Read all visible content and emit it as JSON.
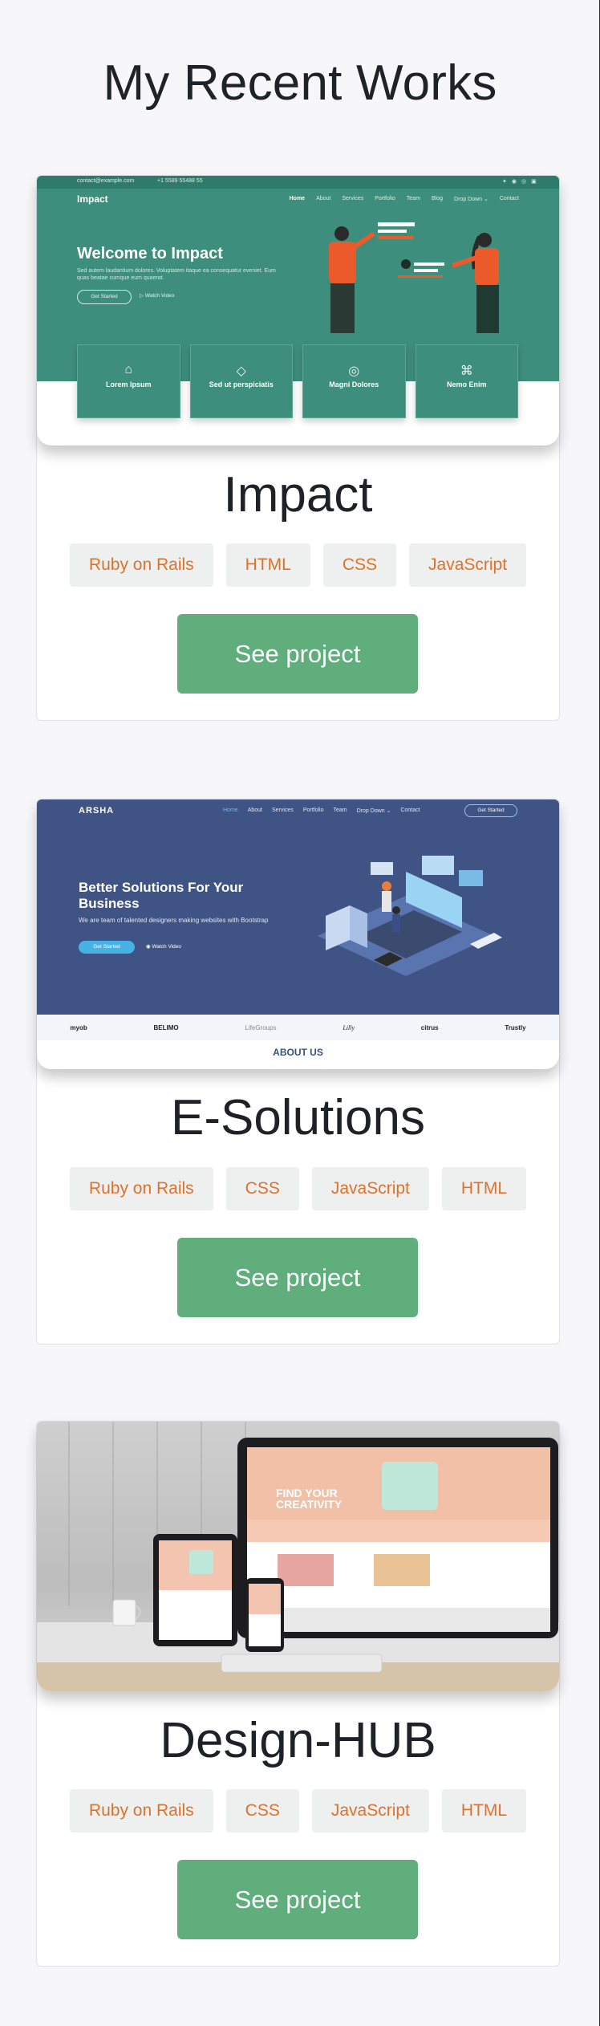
{
  "section": {
    "title": "My Recent Works"
  },
  "projects": [
    {
      "name": "Impact",
      "tags": [
        "Ruby on Rails",
        "HTML",
        "CSS",
        "JavaScript"
      ],
      "button": "See project",
      "preview": {
        "topbar_email": "contact@example.com",
        "topbar_phone": "+1 5589 55488 55",
        "logo": "Impact",
        "nav": [
          "Home",
          "About",
          "Services",
          "Portfolio",
          "Team",
          "Blog",
          "Drop Down ⌄",
          "Contact"
        ],
        "hero_title": "Welcome to Impact",
        "hero_text": "Sed autem laudantium dolores. Voluptatem itaque ea consequatur eveniet. Eum quas beatae cumque eum quaerat.",
        "btn_primary": "Get Started",
        "btn_secondary": "Watch Video",
        "boxes": [
          {
            "icon": "easel-icon",
            "glyph": "⌂",
            "label": "Lorem Ipsum"
          },
          {
            "icon": "gem-icon",
            "glyph": "◇",
            "label": "Sed ut perspiciatis"
          },
          {
            "icon": "location-icon",
            "glyph": "◎",
            "label": "Magni Dolores"
          },
          {
            "icon": "command-icon",
            "glyph": "⌘",
            "label": "Nemo Enim"
          }
        ]
      }
    },
    {
      "name": "E-Solutions",
      "tags": [
        "Ruby on Rails",
        "CSS",
        "JavaScript",
        "HTML"
      ],
      "button": "See project",
      "preview": {
        "logo": "ARSHA",
        "nav": [
          "Home",
          "About",
          "Services",
          "Portfolio",
          "Team",
          "Drop Down ⌄",
          "Contact"
        ],
        "cta": "Get Started",
        "hero_title": "Better Solutions For Your Business",
        "hero_text": "We are team of talented designers making websites with Bootstrap",
        "btn_primary": "Get Started",
        "btn_secondary": "Watch Video",
        "clients": [
          "myob",
          "BELIMO",
          "LifeGroups",
          "Lilly",
          "citrus",
          "Trustly"
        ],
        "about": "ABOUT US"
      }
    },
    {
      "name": "Design-HUB",
      "tags": [
        "Ruby on Rails",
        "CSS",
        "JavaScript",
        "HTML"
      ],
      "button": "See project",
      "preview": {
        "hero_title": "FIND YOUR CREATIVITY"
      }
    }
  ]
}
